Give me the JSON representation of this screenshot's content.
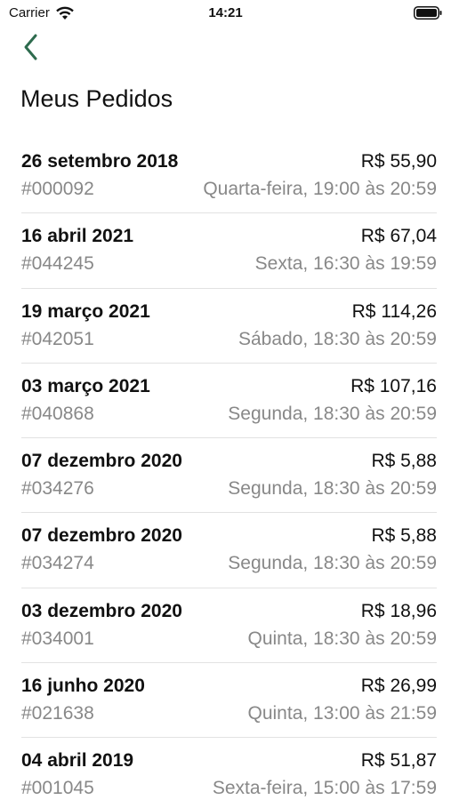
{
  "status_bar": {
    "carrier": "Carrier",
    "time": "14:21"
  },
  "nav": {
    "back_icon": "chevron-left-icon",
    "accent_color": "#2e6b4e"
  },
  "page": {
    "title": "Meus Pedidos"
  },
  "orders": [
    {
      "date": "26 setembro 2018",
      "total": "R$ 55,90",
      "number": "#000092",
      "slot": "Quarta-feira, 19:00 às 20:59"
    },
    {
      "date": "16 abril 2021",
      "total": "R$ 67,04",
      "number": "#044245",
      "slot": "Sexta, 16:30 às 19:59"
    },
    {
      "date": "19 março 2021",
      "total": "R$ 114,26",
      "number": "#042051",
      "slot": "Sábado, 18:30 às 20:59"
    },
    {
      "date": "03 março 2021",
      "total": "R$ 107,16",
      "number": "#040868",
      "slot": "Segunda, 18:30 às 20:59"
    },
    {
      "date": "07 dezembro 2020",
      "total": "R$ 5,88",
      "number": "#034276",
      "slot": "Segunda, 18:30 às 20:59"
    },
    {
      "date": "07 dezembro 2020",
      "total": "R$ 5,88",
      "number": "#034274",
      "slot": "Segunda, 18:30 às 20:59"
    },
    {
      "date": "03 dezembro 2020",
      "total": "R$ 18,96",
      "number": "#034001",
      "slot": "Quinta, 18:30 às 20:59"
    },
    {
      "date": "16 junho 2020",
      "total": "R$ 26,99",
      "number": "#021638",
      "slot": "Quinta, 13:00 às 21:59"
    },
    {
      "date": "04 abril 2019",
      "total": "R$ 51,87",
      "number": "#001045",
      "slot": "Sexta-feira, 15:00 às 17:59"
    }
  ]
}
